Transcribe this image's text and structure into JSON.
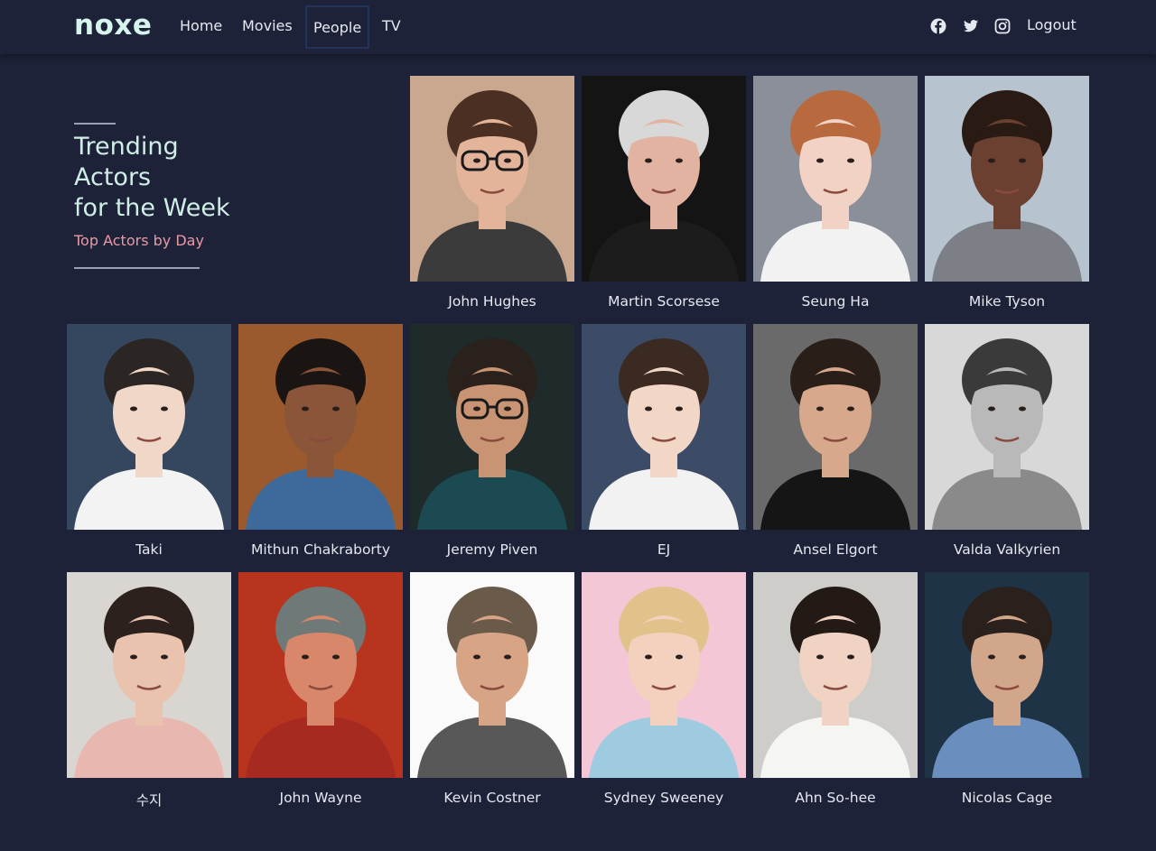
{
  "nav": {
    "brand": "noxe",
    "links": [
      "Home",
      "Movies",
      "People",
      "TV"
    ],
    "active_link": "People",
    "social": [
      "facebook-icon",
      "twitter-icon",
      "instagram-icon"
    ],
    "logout": "Logout"
  },
  "hero": {
    "title_lines": [
      "Trending",
      "Actors",
      "for the Week"
    ],
    "subtitle": "Top Actors by Day"
  },
  "colors": {
    "background": "#1e2238",
    "brand": "#d6f3ec",
    "heading": "#cfeee6",
    "subtitle": "#e89aa6"
  },
  "people": [
    {
      "name": "John Hughes",
      "bg": "#c9a88f",
      "skin": "#e3b49a",
      "hair": "#4a2f22",
      "shirt": "#3b3b3b",
      "glasses": true
    },
    {
      "name": "Martin Scorsese",
      "bg": "#141414",
      "skin": "#e2b3a0",
      "hair": "#d8d8d8",
      "shirt": "#1c1c1c",
      "glasses": false
    },
    {
      "name": "Seung Ha",
      "bg": "#8a8f99",
      "skin": "#f1d2c4",
      "hair": "#b86a3e",
      "shirt": "#f2f2f2",
      "glasses": false
    },
    {
      "name": "Mike Tyson",
      "bg": "#b7c3cf",
      "skin": "#6b4030",
      "hair": "#2a1a14",
      "shirt": "#7c7f86",
      "glasses": false
    },
    {
      "name": "Taki",
      "bg": "#34475f",
      "skin": "#f1d7c8",
      "hair": "#2b2523",
      "shirt": "#f3f3f3",
      "glasses": false
    },
    {
      "name": "Mithun Chakraborty",
      "bg": "#9a5a2e",
      "skin": "#8a5538",
      "hair": "#1a1412",
      "shirt": "#3d6a9a",
      "glasses": false
    },
    {
      "name": "Jeremy Piven",
      "bg": "#1f2a2a",
      "skin": "#c99474",
      "hair": "#2a211c",
      "shirt": "#1c4a52",
      "glasses": true
    },
    {
      "name": "EJ",
      "bg": "#3c4b66",
      "skin": "#f2d6c6",
      "hair": "#3a2a22",
      "shirt": "#f2f2f2",
      "glasses": false
    },
    {
      "name": "Ansel Elgort",
      "bg": "#6a6a6a",
      "skin": "#d7a88c",
      "hair": "#2a1e18",
      "shirt": "#151515",
      "glasses": false
    },
    {
      "name": "Valda Valkyrien",
      "bg": "#d8d8d8",
      "skin": "#b9b9b9",
      "hair": "#3a3a3a",
      "shirt": "#8a8a8a",
      "glasses": false
    },
    {
      "name": "수지",
      "bg": "#d9d6d2",
      "skin": "#e9c3ae",
      "hair": "#2c211c",
      "shirt": "#e8b8b0",
      "glasses": false
    },
    {
      "name": "John Wayne",
      "bg": "#b8341f",
      "skin": "#d8876a",
      "hair": "#6f7a78",
      "shirt": "#a62a1f",
      "glasses": false
    },
    {
      "name": "Kevin Costner",
      "bg": "#fafafa",
      "skin": "#d8a486",
      "hair": "#6a5a4a",
      "shirt": "#585858",
      "glasses": false
    },
    {
      "name": "Sydney Sweeney",
      "bg": "#f3c7d6",
      "skin": "#f4d1bf",
      "hair": "#e1c28a",
      "shirt": "#9ecbe0",
      "glasses": false
    },
    {
      "name": "Ahn So-hee",
      "bg": "#cfcdc9",
      "skin": "#f1d3c3",
      "hair": "#231a16",
      "shirt": "#f5f5f2",
      "glasses": false
    },
    {
      "name": "Nicolas Cage",
      "bg": "#1e3346",
      "skin": "#d2a68b",
      "hair": "#2a211c",
      "shirt": "#6a8fbf",
      "glasses": false
    }
  ]
}
